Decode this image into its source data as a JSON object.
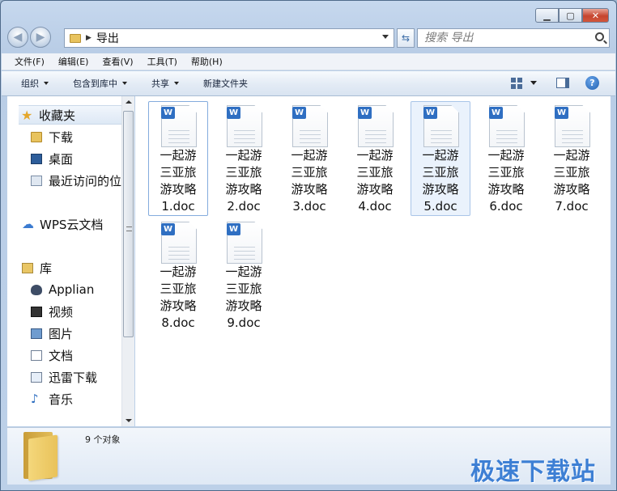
{
  "address": {
    "path": "导出"
  },
  "search": {
    "placeholder": "搜索 导出"
  },
  "menu": [
    "文件(F)",
    "编辑(E)",
    "查看(V)",
    "工具(T)",
    "帮助(H)"
  ],
  "commands": [
    "组织",
    "包含到库中",
    "共享",
    "新建文件夹"
  ],
  "nav": {
    "favorites": "收藏夹",
    "fav_items": [
      "下载",
      "桌面",
      "最近访问的位"
    ],
    "cloud": "WPS云文档",
    "libraries": "库",
    "lib_items": [
      "Applian",
      "视频",
      "图片",
      "文档",
      "迅雷下载",
      "音乐"
    ]
  },
  "files": [
    {
      "l1": "一起游",
      "l2": "三亚旅",
      "l3": "游攻略",
      "l4": "1.doc"
    },
    {
      "l1": "一起游",
      "l2": "三亚旅",
      "l3": "游攻略",
      "l4": "2.doc"
    },
    {
      "l1": "一起游",
      "l2": "三亚旅",
      "l3": "游攻略",
      "l4": "3.doc"
    },
    {
      "l1": "一起游",
      "l2": "三亚旅",
      "l3": "游攻略",
      "l4": "4.doc"
    },
    {
      "l1": "一起游",
      "l2": "三亚旅",
      "l3": "游攻略",
      "l4": "5.doc"
    },
    {
      "l1": "一起游",
      "l2": "三亚旅",
      "l3": "游攻略",
      "l4": "6.doc"
    },
    {
      "l1": "一起游",
      "l2": "三亚旅",
      "l3": "游攻略",
      "l4": "7.doc"
    },
    {
      "l1": "一起游",
      "l2": "三亚旅",
      "l3": "游攻略",
      "l4": "8.doc"
    },
    {
      "l1": "一起游",
      "l2": "三亚旅",
      "l3": "游攻略",
      "l4": "9.doc"
    }
  ],
  "status": {
    "count": "9 个对象"
  },
  "watermark": "极速下载站",
  "colors": {
    "accent": "#3d7fd4",
    "word_badge": "#2f6fc2"
  }
}
